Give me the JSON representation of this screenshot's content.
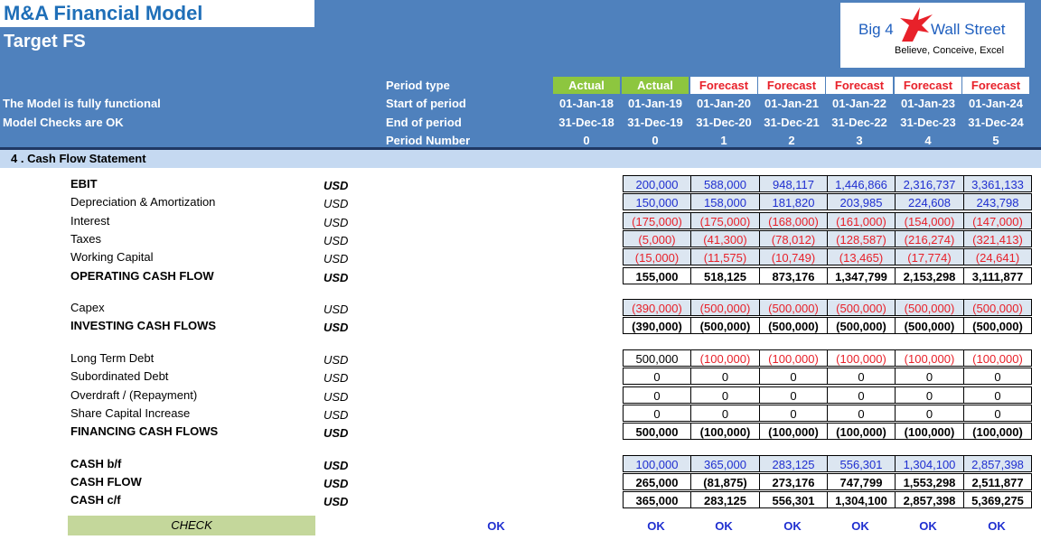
{
  "header": {
    "title": "M&A Financial Model",
    "subtitle": "Target FS",
    "status_functional": "The Model is fully functional",
    "status_checks": "Model Checks are OK",
    "logo_left": "Big 4",
    "logo_right": "Wall Street",
    "logo_tagline": "Believe, Conceive, Excel"
  },
  "periods": {
    "labels": [
      "Period type",
      "Start of period",
      "End of period",
      "Period Number"
    ],
    "columns": [
      {
        "type": "Actual",
        "start": "01-Jan-18",
        "end": "31-Dec-18",
        "number": "0"
      },
      {
        "type": "Actual",
        "start": "01-Jan-19",
        "end": "31-Dec-19",
        "number": "0"
      },
      {
        "type": "Forecast",
        "start": "01-Jan-20",
        "end": "31-Dec-20",
        "number": "1"
      },
      {
        "type": "Forecast",
        "start": "01-Jan-21",
        "end": "31-Dec-21",
        "number": "2"
      },
      {
        "type": "Forecast",
        "start": "01-Jan-22",
        "end": "31-Dec-22",
        "number": "3"
      },
      {
        "type": "Forecast",
        "start": "01-Jan-23",
        "end": "31-Dec-23",
        "number": "4"
      },
      {
        "type": "Forecast",
        "start": "01-Jan-24",
        "end": "31-Dec-24",
        "number": "5"
      }
    ]
  },
  "section_title": "4 .  Cash Flow Statement",
  "rows": [
    {
      "label": "EBIT",
      "unit": "USD",
      "bold": true,
      "values": [
        "200,000",
        "588,000",
        "948,117",
        "1,446,866",
        "2,316,737",
        "3,361,133"
      ]
    },
    {
      "label": "Depreciation & Amortization",
      "unit": "USD",
      "bold": false,
      "values": [
        "150,000",
        "158,000",
        "181,820",
        "203,985",
        "224,608",
        "243,798"
      ]
    },
    {
      "label": "Interest",
      "unit": "USD",
      "bold": false,
      "values": [
        "(175,000)",
        "(175,000)",
        "(168,000)",
        "(161,000)",
        "(154,000)",
        "(147,000)"
      ]
    },
    {
      "label": "Taxes",
      "unit": "USD",
      "bold": false,
      "values": [
        "(5,000)",
        "(41,300)",
        "(78,012)",
        "(128,587)",
        "(216,274)",
        "(321,413)"
      ]
    },
    {
      "label": "Working Capital",
      "unit": "USD",
      "bold": false,
      "values": [
        "(15,000)",
        "(11,575)",
        "(10,749)",
        "(13,465)",
        "(17,774)",
        "(24,641)"
      ]
    },
    {
      "label": "OPERATING CASH FLOW",
      "unit": "USD",
      "bold": true,
      "values": [
        "155,000",
        "518,125",
        "873,176",
        "1,347,799",
        "2,153,298",
        "3,111,877"
      ]
    },
    {
      "label": "Capex",
      "unit": "USD",
      "bold": false,
      "values": [
        "(390,000)",
        "(500,000)",
        "(500,000)",
        "(500,000)",
        "(500,000)",
        "(500,000)"
      ]
    },
    {
      "label": "INVESTING CASH FLOWS",
      "unit": "USD",
      "bold": true,
      "values": [
        "(390,000)",
        "(500,000)",
        "(500,000)",
        "(500,000)",
        "(500,000)",
        "(500,000)"
      ]
    },
    {
      "label": "Long Term Debt",
      "unit": "USD",
      "bold": false,
      "values": [
        "500,000",
        "(100,000)",
        "(100,000)",
        "(100,000)",
        "(100,000)",
        "(100,000)"
      ]
    },
    {
      "label": "Subordinated Debt",
      "unit": "USD",
      "bold": false,
      "values": [
        "0",
        "0",
        "0",
        "0",
        "0",
        "0"
      ]
    },
    {
      "label": "Overdraft / (Repayment)",
      "unit": "USD",
      "bold": false,
      "values": [
        "0",
        "0",
        "0",
        "0",
        "0",
        "0"
      ]
    },
    {
      "label": "Share Capital Increase",
      "unit": "USD",
      "bold": false,
      "values": [
        "0",
        "0",
        "0",
        "0",
        "0",
        "0"
      ]
    },
    {
      "label": "FINANCING CASH FLOWS",
      "unit": "USD",
      "bold": true,
      "values": [
        "500,000",
        "(100,000)",
        "(100,000)",
        "(100,000)",
        "(100,000)",
        "(100,000)"
      ]
    },
    {
      "label": "CASH b/f",
      "unit": "USD",
      "bold": true,
      "values": [
        "100,000",
        "365,000",
        "283,125",
        "556,301",
        "1,304,100",
        "2,857,398"
      ]
    },
    {
      "label": "CASH FLOW",
      "unit": "USD",
      "bold": true,
      "values": [
        "265,000",
        "(81,875)",
        "273,176",
        "747,799",
        "1,553,298",
        "2,511,877"
      ]
    },
    {
      "label": "CASH c/f",
      "unit": "USD",
      "bold": true,
      "values": [
        "365,000",
        "283,125",
        "556,301",
        "1,304,100",
        "2,857,398",
        "5,369,275"
      ]
    }
  ],
  "check": {
    "label": "CHECK",
    "summary": "OK",
    "values": [
      "OK",
      "OK",
      "OK",
      "OK",
      "OK",
      "OK"
    ]
  },
  "colors": {
    "header_blue": "#4f81bd",
    "actual_green": "#8dc63f",
    "forecast_red": "#e8212a",
    "input_blue_text": "#1f2fd0",
    "input_fill": "#dce6f1",
    "check_green": "#c4d79b"
  }
}
